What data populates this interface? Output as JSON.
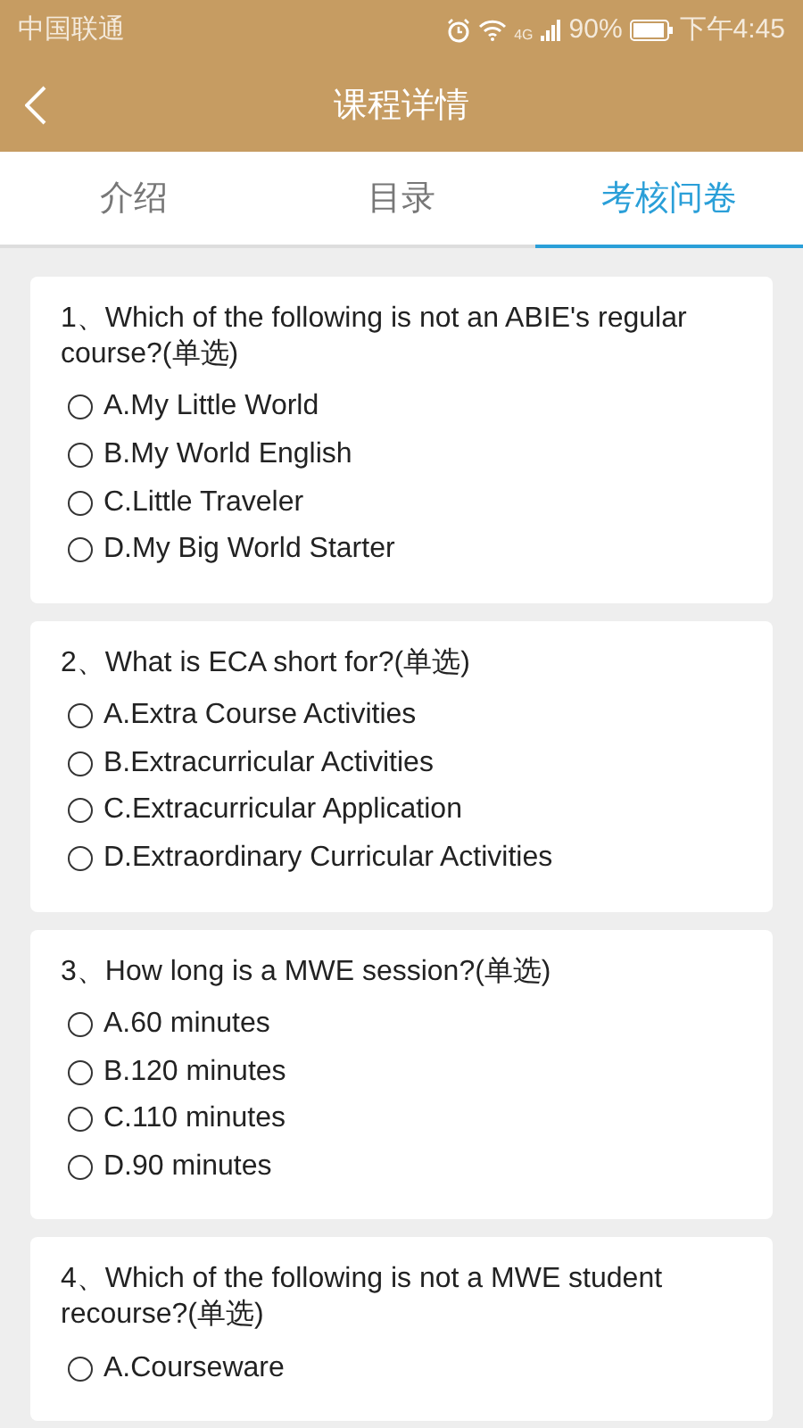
{
  "status_bar": {
    "carrier": "中国联通",
    "network": "4G",
    "battery": "90%",
    "time": "下午4:45"
  },
  "header": {
    "title": "课程详情"
  },
  "tabs": [
    {
      "label": "介绍",
      "selected": false
    },
    {
      "label": "目录",
      "selected": false
    },
    {
      "label": "考核问卷",
      "selected": true
    }
  ],
  "questions": [
    {
      "text": "1、Which of the following is not an ABIE's regular course?(单选)",
      "options": [
        {
          "label": "A.My Little World",
          "selected": false
        },
        {
          "label": "B.My World English",
          "selected": false
        },
        {
          "label": "C.Little Traveler",
          "selected": false
        },
        {
          "label": "D.My Big World Starter",
          "selected": false
        }
      ]
    },
    {
      "text": "2、What is ECA short for?(单选)",
      "options": [
        {
          "label": "A.Extra Course Activities",
          "selected": false
        },
        {
          "label": "B.Extracurricular Activities",
          "selected": false
        },
        {
          "label": "C.Extracurricular Application",
          "selected": false
        },
        {
          "label": "D.Extraordinary Curricular Activities",
          "selected": false
        }
      ]
    },
    {
      "text": "3、How long is a MWE session?(单选)",
      "options": [
        {
          "label": "A.60 minutes",
          "selected": false
        },
        {
          "label": "B.120 minutes",
          "selected": false
        },
        {
          "label": "C.110 minutes",
          "selected": false
        },
        {
          "label": "D.90 minutes",
          "selected": false
        }
      ]
    },
    {
      "text": "4、Which of the following is not a MWE student recourse?(单选)",
      "options": [
        {
          "label": "A.Courseware",
          "selected": false
        }
      ]
    }
  ]
}
